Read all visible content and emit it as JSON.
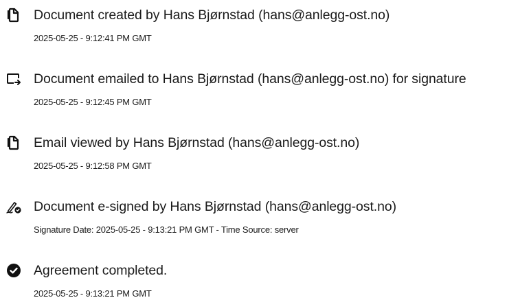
{
  "events": [
    {
      "icon": "document-created-icon",
      "title": "Document created by Hans Bjørnstad (hans@anlegg-ost.no)",
      "detail": "2025-05-25 - 9:12:41 PM GMT"
    },
    {
      "icon": "email-sent-icon",
      "title": "Document emailed to Hans Bjørnstad (hans@anlegg-ost.no) for signature",
      "detail": "2025-05-25 - 9:12:45 PM GMT"
    },
    {
      "icon": "document-viewed-icon",
      "title": "Email viewed by Hans Bjørnstad (hans@anlegg-ost.no)",
      "detail": "2025-05-25 - 9:12:58 PM GMT"
    },
    {
      "icon": "e-sign-pen-icon",
      "title": "Document e-signed by Hans Bjørnstad (hans@anlegg-ost.no)",
      "detail": "Signature Date: 2025-05-25 - 9:13:21 PM GMT - Time Source: server"
    },
    {
      "icon": "check-circle-icon",
      "title": "Agreement completed.",
      "detail": "2025-05-25 - 9:13:21 PM GMT"
    }
  ]
}
